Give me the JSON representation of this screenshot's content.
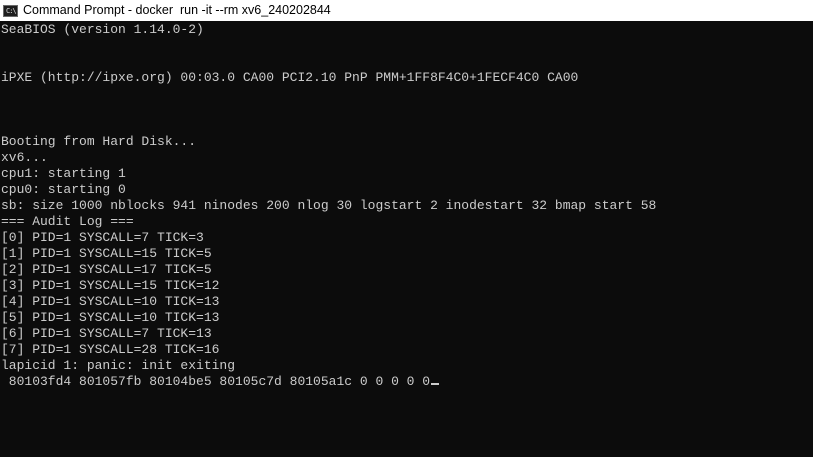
{
  "window": {
    "title": "Command Prompt - docker  run -it --rm xv6_240202844",
    "icon": "command-prompt-icon",
    "icon_glyph": "C:\\"
  },
  "console": {
    "lines": [
      "SeaBIOS (version 1.14.0-2)",
      "",
      "",
      "iPXE (http://ipxe.org) 00:03.0 CA00 PCI2.10 PnP PMM+1FF8F4C0+1FECF4C0 CA00",
      "",
      "",
      "",
      "Booting from Hard Disk...",
      "xv6...",
      "cpu1: starting 1",
      "cpu0: starting 0",
      "sb: size 1000 nblocks 941 ninodes 200 nlog 30 logstart 2 inodestart 32 bmap start 58",
      "=== Audit Log ===",
      "[0] PID=1 SYSCALL=7 TICK=3",
      "[1] PID=1 SYSCALL=15 TICK=5",
      "[2] PID=1 SYSCALL=17 TICK=5",
      "[3] PID=1 SYSCALL=15 TICK=12",
      "[4] PID=1 SYSCALL=10 TICK=13",
      "[5] PID=1 SYSCALL=10 TICK=13",
      "[6] PID=1 SYSCALL=7 TICK=13",
      "[7] PID=1 SYSCALL=28 TICK=16",
      "lapicid 1: panic: init exiting",
      " 80103fd4 801057fb 80104be5 80105c7d 80105a1c 0 0 0 0 0"
    ]
  },
  "colors": {
    "background": "#0c0c0c",
    "text": "#cccccc",
    "titlebar": "#ffffff"
  }
}
